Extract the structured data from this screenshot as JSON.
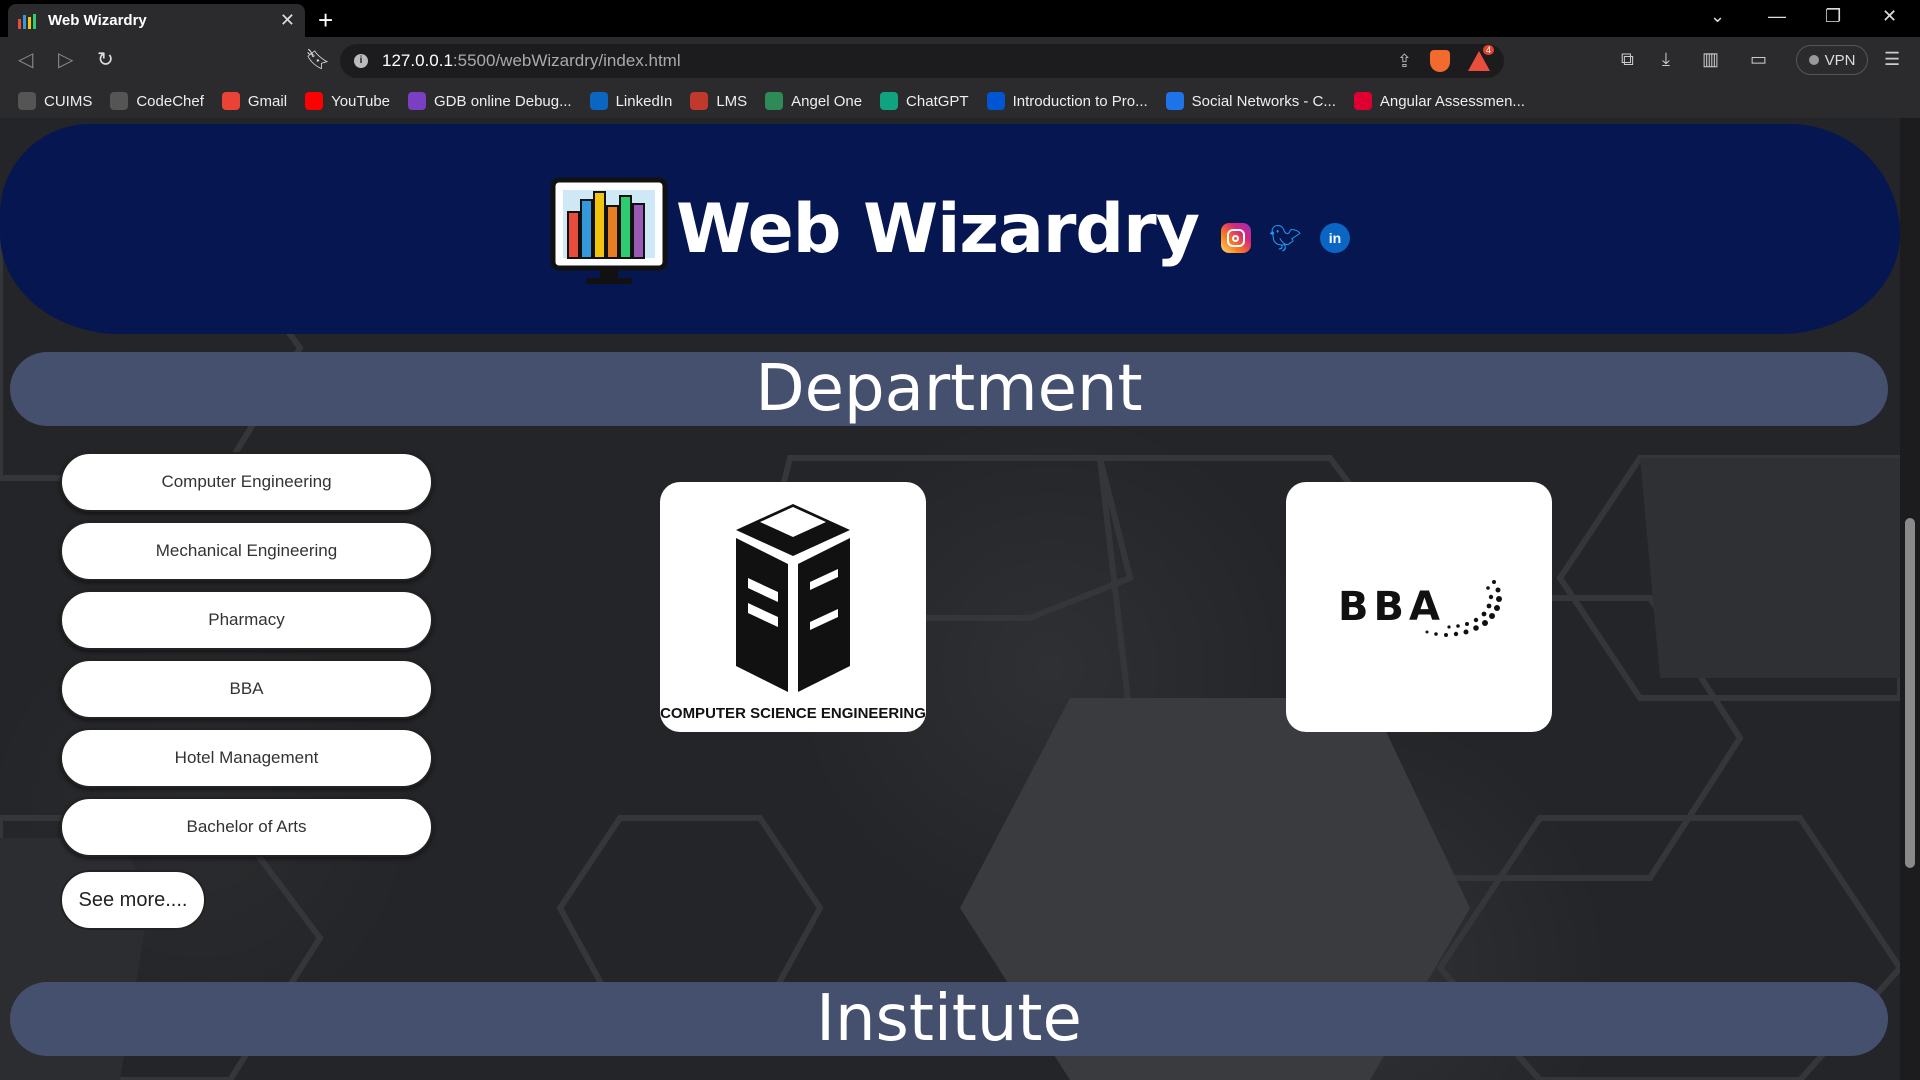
{
  "browser": {
    "tab_title": "Web Wizardry",
    "url_host": "127.0.0.1",
    "url_path": ":5500/webWizardry/index.html",
    "shield_count": "4",
    "vpn_label": "VPN",
    "bookmarks": [
      {
        "label": "CUIMS",
        "icon": "globe-icon",
        "color": "#555555"
      },
      {
        "label": "CodeChef",
        "icon": "globe-icon",
        "color": "#555555"
      },
      {
        "label": "Gmail",
        "icon": "gmail-icon",
        "color": "#ea4335"
      },
      {
        "label": "YouTube",
        "icon": "youtube-icon",
        "color": "#ff0000"
      },
      {
        "label": "GDB online Debug...",
        "icon": "gdb-icon",
        "color": "#7b3fc4"
      },
      {
        "label": "LinkedIn",
        "icon": "linkedin-icon",
        "color": "#0a66c2"
      },
      {
        "label": "LMS",
        "icon": "lms-icon",
        "color": "#c0392b"
      },
      {
        "label": "Angel One",
        "icon": "angel-one-icon",
        "color": "#2e8b57"
      },
      {
        "label": "ChatGPT",
        "icon": "chatgpt-icon",
        "color": "#10a37f"
      },
      {
        "label": "Introduction to Pro...",
        "icon": "coursera-icon",
        "color": "#0056d2"
      },
      {
        "label": "Social Networks - C...",
        "icon": "social-icon",
        "color": "#1e73e8"
      },
      {
        "label": "Angular Assessmen...",
        "icon": "angular-icon",
        "color": "#dd0031"
      }
    ]
  },
  "page": {
    "brand": "Web Wizardry",
    "department_heading": "Department",
    "institute_heading": "Institute",
    "departments": [
      "Computer Engineering",
      "Mechanical Engineering",
      "Pharmacy",
      "BBA",
      "Hotel Management",
      "Bachelor of Arts"
    ],
    "see_more": "See more....",
    "cse_card_caption": "COMPUTER  SCIENCE  ENGINEERING",
    "bba_card_text": "BBA"
  },
  "colors": {
    "header_bg": "#061650",
    "section_bar": "#45506f",
    "page_bg": "#242528"
  }
}
